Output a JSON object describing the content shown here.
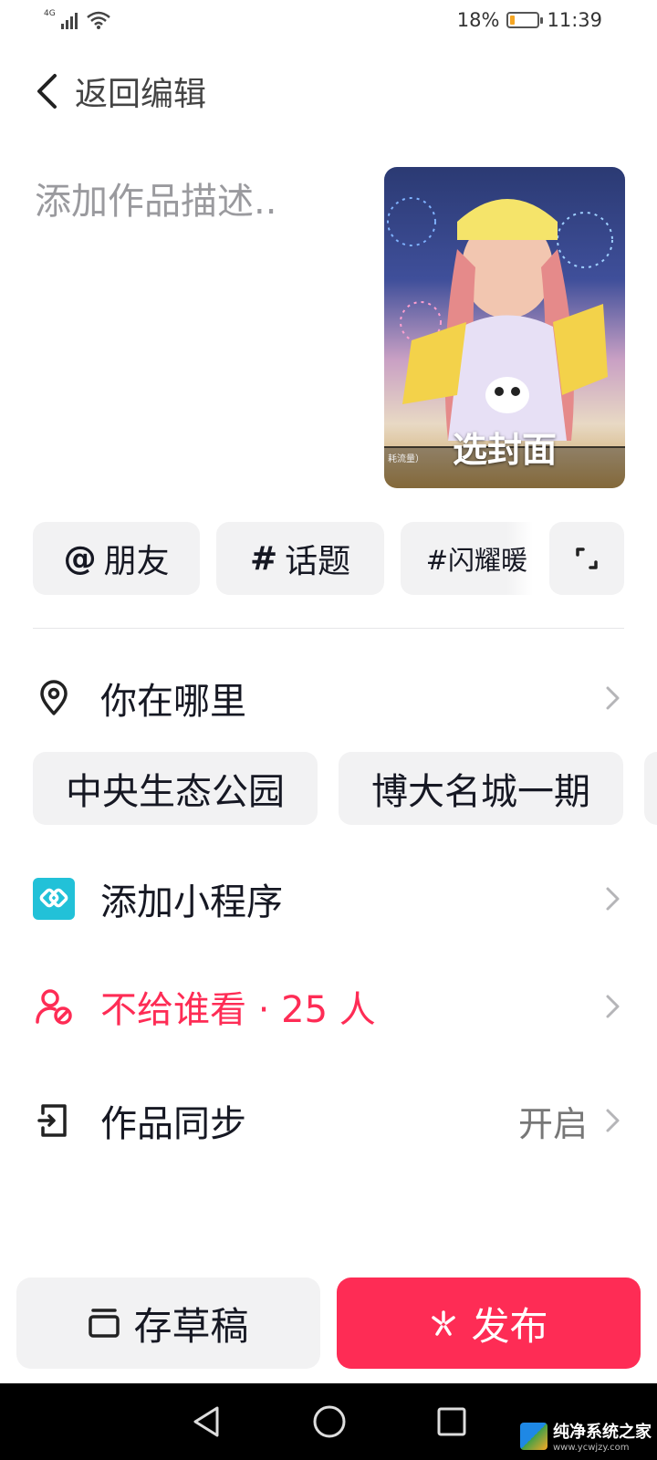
{
  "status_bar": {
    "network": "4G",
    "battery_percent": "18%",
    "battery_level": 0.18,
    "time": "11:39"
  },
  "header": {
    "back_label": "返回编辑"
  },
  "description": {
    "placeholder": "添加作品描述.."
  },
  "cover": {
    "label": "选封面",
    "overlay_text": "耗流量）"
  },
  "chips": {
    "friends": "朋友",
    "friends_prefix": "@",
    "topic": "话题",
    "topic_prefix": "#",
    "trend": "#闪耀暖"
  },
  "location": {
    "label": "你在哪里",
    "suggestions": [
      "中央生态公园",
      "博大名城一期"
    ]
  },
  "mini_program": {
    "label": "添加小程序"
  },
  "privacy": {
    "label": "不给谁看 · 25 人",
    "color": "#fe2c55"
  },
  "sync": {
    "label": "作品同步",
    "value": "开启"
  },
  "buttons": {
    "draft": "存草稿",
    "publish": "发布",
    "publish_color": "#fe2c55"
  },
  "watermark": {
    "title": "纯净系统之家",
    "url": "www.ycwjzy.com"
  },
  "icons": {
    "back": "chevron-left-icon",
    "location": "location-pin-icon",
    "mini_program": "mini-program-icon",
    "privacy": "user-blocked-icon",
    "sync": "sync-export-icon",
    "draft": "draft-box-icon",
    "publish": "sparkle-icon"
  }
}
